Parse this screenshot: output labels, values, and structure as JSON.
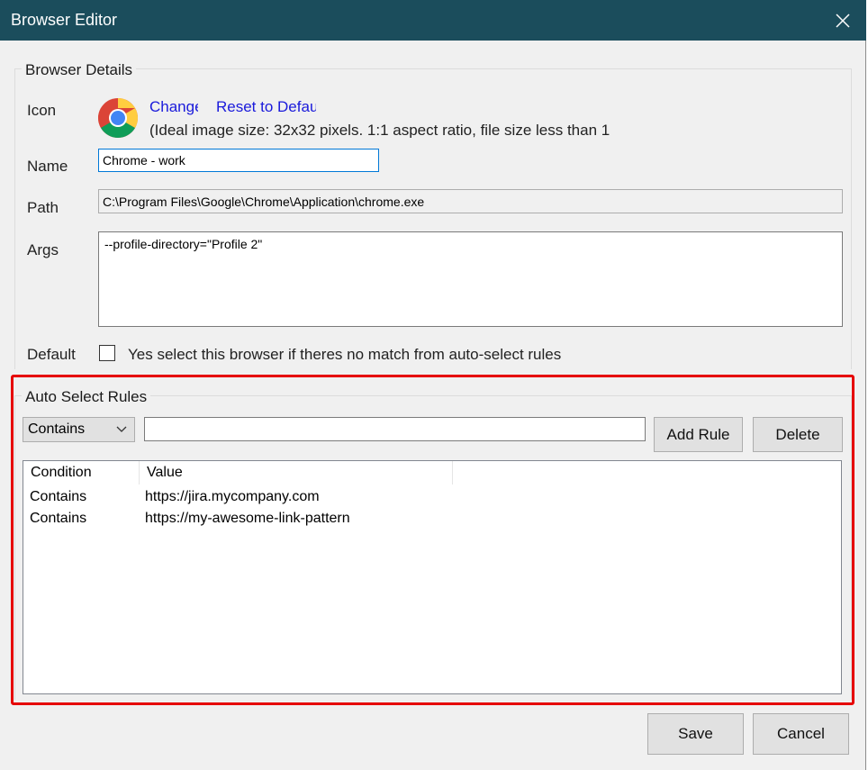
{
  "window": {
    "title": "Browser Editor",
    "accent_color": "#1b4d5c"
  },
  "browser_details": {
    "group_title": "Browser Details",
    "icon_label": "Icon",
    "change_link": "Change",
    "reset_link": "Reset to Default",
    "image_note": "(Ideal image size: 32x32 pixels. 1:1 aspect ratio, file size less than 1",
    "name_label": "Name",
    "name_value": "Chrome - work",
    "path_label": "Path",
    "path_value": "C:\\Program Files\\Google\\Chrome\\Application\\chrome.exe",
    "args_label": "Args",
    "args_value": "--profile-directory=\"Profile 2\"",
    "default_label": "Default",
    "default_checkbox_label": "Yes select this browser if theres no match from auto-select rules",
    "default_checked": false
  },
  "auto_select": {
    "group_title": "Auto Select Rules",
    "condition_selected": "Contains",
    "rule_input_value": "",
    "add_rule_label": "Add Rule",
    "delete_label": "Delete",
    "columns": [
      "Condition",
      "Value"
    ],
    "rows": [
      {
        "condition": "Contains",
        "value": "https://jira.mycompany.com"
      },
      {
        "condition": "Contains",
        "value": "https://my-awesome-link-pattern"
      }
    ],
    "highlight_color": "#e60000"
  },
  "footer": {
    "save_label": "Save",
    "cancel_label": "Cancel"
  },
  "icons": {
    "app_icon": "chrome-icon",
    "close": "close-icon",
    "dropdown": "chevron-down-icon"
  }
}
